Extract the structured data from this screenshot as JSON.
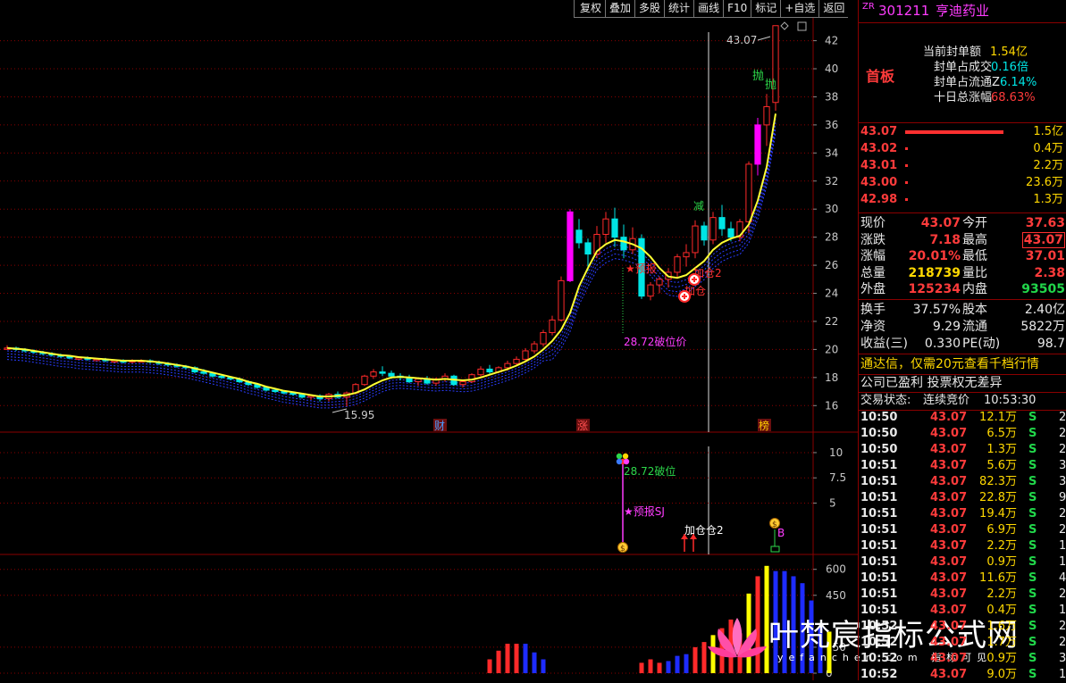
{
  "toolbar": {
    "items": [
      "复权",
      "叠加",
      "多股",
      "统计",
      "画线",
      "F10",
      "标记",
      "+自选",
      "返回"
    ]
  },
  "stock": {
    "prefix": "ZR",
    "code": "301211",
    "name": "亨迪药业"
  },
  "board_label": "首板",
  "seal_info": [
    {
      "label": "当前封单额",
      "value": "1.54亿"
    },
    {
      "label": "封单占成交",
      "value": "0.16倍"
    },
    {
      "label": "封单占流通Z",
      "value": "6.14%"
    },
    {
      "label": "十日总涨幅",
      "value": "68.63%"
    }
  ],
  "order_book": [
    {
      "price": "43.07",
      "vol": "1.5亿",
      "bar": 1.0
    },
    {
      "price": "43.02",
      "vol": "0.4万",
      "bar": 0.02
    },
    {
      "price": "43.01",
      "vol": "2.2万",
      "bar": 0.02
    },
    {
      "price": "43.00",
      "vol": "23.6万",
      "bar": 0.02
    },
    {
      "price": "42.98",
      "vol": "1.3万",
      "bar": 0.02
    }
  ],
  "quote": [
    {
      "l1": "现价",
      "v1": "43.07",
      "l2": "今开",
      "v2": "37.63"
    },
    {
      "l1": "涨跌",
      "v1": "7.18",
      "l2": "最高",
      "v2": "43.07"
    },
    {
      "l1": "涨幅",
      "v1": "20.01%",
      "l2": "最低",
      "v2": "37.01"
    },
    {
      "l1": "总量",
      "v1": "218739",
      "l2": "量比",
      "v2": "2.38"
    },
    {
      "l1": "外盘",
      "v1": "125234",
      "l2": "内盘",
      "v2": "93505"
    }
  ],
  "finance": [
    {
      "l1": "换手",
      "v1": "37.57%",
      "l2": "股本",
      "v2": "2.40亿"
    },
    {
      "l1": "净资",
      "v1": "9.29",
      "l2": "流通",
      "v2": "5822万"
    },
    {
      "l1": "收益(三)",
      "v1": "0.330",
      "l2": "PE(动)",
      "v2": "98.7"
    }
  ],
  "promo": "通达信，仅需20元查看千档行情",
  "notice": "公司已盈利 投票权无差异",
  "trade_state": {
    "label": "交易状态:",
    "state": "连续竞价",
    "time": "10:53:30"
  },
  "ticks": [
    {
      "t": "10:50",
      "p": "43.07",
      "v": "12.1万",
      "s": "S",
      "n": "2"
    },
    {
      "t": "10:50",
      "p": "43.07",
      "v": "6.5万",
      "s": "S",
      "n": "2"
    },
    {
      "t": "10:50",
      "p": "43.07",
      "v": "1.3万",
      "s": "S",
      "n": "2"
    },
    {
      "t": "10:51",
      "p": "43.07",
      "v": "5.6万",
      "s": "S",
      "n": "3"
    },
    {
      "t": "10:51",
      "p": "43.07",
      "v": "82.3万",
      "s": "S",
      "n": "3"
    },
    {
      "t": "10:51",
      "p": "43.07",
      "v": "22.8万",
      "s": "S",
      "n": "9"
    },
    {
      "t": "10:51",
      "p": "43.07",
      "v": "19.4万",
      "s": "S",
      "n": "2"
    },
    {
      "t": "10:51",
      "p": "43.07",
      "v": "6.9万",
      "s": "S",
      "n": "2"
    },
    {
      "t": "10:51",
      "p": "43.07",
      "v": "2.2万",
      "s": "S",
      "n": "1"
    },
    {
      "t": "10:51",
      "p": "43.07",
      "v": "0.9万",
      "s": "S",
      "n": "1"
    },
    {
      "t": "10:51",
      "p": "43.07",
      "v": "11.6万",
      "s": "S",
      "n": "4"
    },
    {
      "t": "10:51",
      "p": "43.07",
      "v": "2.2万",
      "s": "S",
      "n": "2"
    },
    {
      "t": "10:51",
      "p": "43.07",
      "v": "0.4万",
      "s": "S",
      "n": "1"
    },
    {
      "t": "10:52",
      "p": "43.07",
      "v": "1.6万",
      "s": "S",
      "n": "2"
    },
    {
      "t": "10:52",
      "p": "43.07",
      "v": "1.7万",
      "s": "S",
      "n": "2"
    },
    {
      "t": "10:52",
      "p": "43.07",
      "v": "0.9万",
      "s": "S",
      "n": "3"
    },
    {
      "t": "10:52",
      "p": "43.07",
      "v": "9.0万",
      "s": "S",
      "n": "1"
    }
  ],
  "chart_labels": {
    "high_mark": "43.07",
    "low_mark": "15.95",
    "break_price": "28.72破位价",
    "break_sub": "28.72破位",
    "forecast": "★预报",
    "forecast_sj": "★预报SJ",
    "add_pos": "加仓",
    "add_pos2": "加仓2",
    "add_pos_sub": "加仓仓2",
    "reduce": "减",
    "sell1": "抛",
    "sell2": "抛",
    "b_mark": "B",
    "marker_cai": "财",
    "marker_zhang": "涨",
    "marker_bang": "榜"
  },
  "watermark": {
    "text": "叶梵宸指标公式网",
    "url": "yefanchen.com 指标可见"
  },
  "colors": {
    "up": "#ff2a2a",
    "down": "#00e5e5",
    "limit": "#ff00ff",
    "ma": "#ffff33",
    "band": "#2a3cff",
    "grid": "#8a0000",
    "axis": "#c8c8c8"
  },
  "chart_data": [
    {
      "type": "candlestick",
      "title": "",
      "y_ticks": [
        16,
        18,
        20,
        22,
        24,
        26,
        28,
        30,
        32,
        34,
        36,
        38,
        40,
        42
      ],
      "ylim": [
        15,
        43.5
      ],
      "candles": [
        [
          20.1,
          20.3,
          20.0,
          20.1
        ],
        [
          20.1,
          20.2,
          19.9,
          20.0
        ],
        [
          20.0,
          20.1,
          19.8,
          19.9
        ],
        [
          19.9,
          20.0,
          19.7,
          19.8
        ],
        [
          19.8,
          19.9,
          19.6,
          19.7
        ],
        [
          19.7,
          19.8,
          19.5,
          19.6
        ],
        [
          19.6,
          19.7,
          19.4,
          19.5
        ],
        [
          19.5,
          19.6,
          19.3,
          19.4
        ],
        [
          19.4,
          19.5,
          19.3,
          19.4
        ],
        [
          19.4,
          19.5,
          19.2,
          19.3
        ],
        [
          19.3,
          19.4,
          19.2,
          19.3
        ],
        [
          19.3,
          19.4,
          19.1,
          19.2
        ],
        [
          19.2,
          19.3,
          19.1,
          19.2
        ],
        [
          19.2,
          19.3,
          19.0,
          19.1
        ],
        [
          19.1,
          19.3,
          19.0,
          19.2
        ],
        [
          19.2,
          19.3,
          19.1,
          19.2
        ],
        [
          19.2,
          19.3,
          19.0,
          19.1
        ],
        [
          19.1,
          19.2,
          18.9,
          19.0
        ],
        [
          19.0,
          19.1,
          18.8,
          18.9
        ],
        [
          18.9,
          19.0,
          18.7,
          18.8
        ],
        [
          18.8,
          18.9,
          18.6,
          18.7
        ],
        [
          18.7,
          18.8,
          18.3,
          18.4
        ],
        [
          18.4,
          18.6,
          18.2,
          18.3
        ],
        [
          18.3,
          18.4,
          18.0,
          18.1
        ],
        [
          18.1,
          18.2,
          17.9,
          18.0
        ],
        [
          18.0,
          18.1,
          17.8,
          17.9
        ],
        [
          17.9,
          18.0,
          17.6,
          17.7
        ],
        [
          17.7,
          17.8,
          17.4,
          17.5
        ],
        [
          17.5,
          17.6,
          17.2,
          17.3
        ],
        [
          17.3,
          17.4,
          17.0,
          17.1
        ],
        [
          17.1,
          17.2,
          16.9,
          17.0
        ],
        [
          17.0,
          17.1,
          16.8,
          16.9
        ],
        [
          16.9,
          17.0,
          16.7,
          16.8
        ],
        [
          16.8,
          16.9,
          16.5,
          16.6
        ],
        [
          16.6,
          16.8,
          16.4,
          16.7
        ],
        [
          16.7,
          16.8,
          16.3,
          16.5
        ],
        [
          16.5,
          16.9,
          16.3,
          16.8
        ],
        [
          16.8,
          17.0,
          16.5,
          16.6
        ],
        [
          16.6,
          17.0,
          15.95,
          16.9
        ],
        [
          16.9,
          17.6,
          16.8,
          17.5
        ],
        [
          17.5,
          18.2,
          17.4,
          18.1
        ],
        [
          18.1,
          18.6,
          17.9,
          18.4
        ],
        [
          18.4,
          18.8,
          18.1,
          18.3
        ],
        [
          18.3,
          18.5,
          17.9,
          18.1
        ],
        [
          18.1,
          18.3,
          17.8,
          18.0
        ],
        [
          18.0,
          18.2,
          17.6,
          17.7
        ],
        [
          17.7,
          18.0,
          17.4,
          17.9
        ],
        [
          17.9,
          18.1,
          17.5,
          17.6
        ],
        [
          17.6,
          18.0,
          17.4,
          17.9
        ],
        [
          17.9,
          18.3,
          17.7,
          18.1
        ],
        [
          18.1,
          18.2,
          17.4,
          17.5
        ],
        [
          17.5,
          17.8,
          17.3,
          17.7
        ],
        [
          17.7,
          18.3,
          17.6,
          18.2
        ],
        [
          18.2,
          18.8,
          18.0,
          18.6
        ],
        [
          18.6,
          18.9,
          18.2,
          18.4
        ],
        [
          18.4,
          18.8,
          18.3,
          18.7
        ],
        [
          18.7,
          19.2,
          18.5,
          19.0
        ],
        [
          19.0,
          19.5,
          18.8,
          19.3
        ],
        [
          19.3,
          20.1,
          19.1,
          19.9
        ],
        [
          19.9,
          20.6,
          19.7,
          20.4
        ],
        [
          20.4,
          21.4,
          20.2,
          21.2
        ],
        [
          21.2,
          22.4,
          21.0,
          22.1
        ],
        [
          22.1,
          25.2,
          22.0,
          24.9
        ],
        [
          24.9,
          30.0,
          24.8,
          29.8
        ],
        [
          28.5,
          29.3,
          27.2,
          27.6
        ],
        [
          27.6,
          27.9,
          25.6,
          26.8
        ],
        [
          26.8,
          28.8,
          26.5,
          28.2
        ],
        [
          28.2,
          29.8,
          27.6,
          29.3
        ],
        [
          29.3,
          30.1,
          27.3,
          28.0
        ],
        [
          28.0,
          28.9,
          26.5,
          27.1
        ],
        [
          27.1,
          28.7,
          26.8,
          27.9
        ],
        [
          27.9,
          28.2,
          23.6,
          23.8
        ],
        [
          23.8,
          24.8,
          23.5,
          24.6
        ],
        [
          24.6,
          25.2,
          24.0,
          25.0
        ],
        [
          25.0,
          25.8,
          24.4,
          25.5
        ],
        [
          25.5,
          26.8,
          25.1,
          26.6
        ],
        [
          26.6,
          27.5,
          25.9,
          26.9
        ],
        [
          26.9,
          29.2,
          26.5,
          28.8
        ],
        [
          28.8,
          29.1,
          27.4,
          27.8
        ],
        [
          27.8,
          29.8,
          27.5,
          29.4
        ],
        [
          29.4,
          30.3,
          28.1,
          28.6
        ],
        [
          28.6,
          29.1,
          27.7,
          28.0
        ],
        [
          28.0,
          29.3,
          27.7,
          29.1
        ],
        [
          29.1,
          33.4,
          28.3,
          33.2
        ],
        [
          33.2,
          36.5,
          32.4,
          36.0
        ],
        [
          36.0,
          38.2,
          34.5,
          37.3
        ],
        [
          37.6,
          43.07,
          37.01,
          43.07
        ]
      ],
      "ma": [
        20.1,
        20.05,
        20.0,
        19.9,
        19.8,
        19.7,
        19.6,
        19.55,
        19.45,
        19.4,
        19.35,
        19.3,
        19.25,
        19.2,
        19.2,
        19.2,
        19.15,
        19.1,
        19.0,
        18.9,
        18.8,
        18.65,
        18.5,
        18.35,
        18.2,
        18.05,
        17.9,
        17.7,
        17.55,
        17.35,
        17.2,
        17.05,
        16.95,
        16.85,
        16.75,
        16.65,
        16.65,
        16.7,
        16.75,
        16.9,
        17.15,
        17.5,
        17.8,
        18.0,
        18.05,
        18.0,
        17.95,
        17.9,
        17.85,
        17.9,
        17.85,
        17.8,
        17.85,
        18.0,
        18.2,
        18.4,
        18.6,
        18.85,
        19.15,
        19.5,
        20.0,
        20.6,
        21.4,
        22.6,
        24.5,
        25.8,
        27.0,
        27.5,
        27.8,
        27.7,
        27.5,
        27.2,
        26.6,
        25.8,
        25.2,
        25.1,
        25.3,
        25.8,
        26.3,
        27.1,
        27.6,
        27.9,
        28.1,
        28.9,
        30.6,
        33.0,
        36.8
      ]
    },
    {
      "type": "signal",
      "y_ticks": [
        5.0,
        7.5,
        10.0
      ],
      "ylim": [
        0,
        11.5
      ]
    },
    {
      "type": "bar",
      "y_ticks": [
        0,
        150,
        450,
        600
      ],
      "ylim": [
        0,
        650
      ],
      "bars": [
        [
          54,
          "#ff2a2a",
          80
        ],
        [
          55,
          "#ff2a2a",
          130
        ],
        [
          56,
          "#ff2a2a",
          170
        ],
        [
          57,
          "#ff2a2a",
          170
        ],
        [
          58,
          "#1e2cff",
          170
        ],
        [
          59,
          "#1e2cff",
          120
        ],
        [
          60,
          "#1e2cff",
          80
        ],
        [
          71,
          "#ff2a2a",
          60
        ],
        [
          72,
          "#ff2a2a",
          80
        ],
        [
          73,
          "#ff2a2a",
          60
        ],
        [
          74,
          "#1e2cff",
          70
        ],
        [
          75,
          "#1e2cff",
          100
        ],
        [
          76,
          "#1e2cff",
          110
        ],
        [
          77,
          "#ff2a2a",
          150
        ],
        [
          78,
          "#ff2a2a",
          180
        ],
        [
          79,
          "#ffff00",
          220
        ],
        [
          80,
          "#ff2a2a",
          260
        ],
        [
          81,
          "#ff2a2a",
          310
        ],
        [
          82,
          "#ff2a2a",
          230
        ],
        [
          83,
          "#ffff00",
          460
        ],
        [
          84,
          "#ff2a2a",
          560
        ],
        [
          85,
          "#ffff00",
          620
        ],
        [
          86,
          "#1e2cff",
          590
        ],
        [
          87,
          "#1e2cff",
          590
        ],
        [
          88,
          "#1e2cff",
          560
        ],
        [
          89,
          "#1e2cff",
          520
        ],
        [
          90,
          "#1e2cff",
          420
        ],
        [
          91,
          "#1e2cff",
          270
        ],
        [
          92,
          "#ffff00",
          240
        ],
        [
          101,
          "#ffff00",
          70
        ],
        [
          102,
          "#ff2a2a",
          120
        ],
        [
          103,
          "#ff2a2a",
          160
        ],
        [
          104,
          "#ff2a2a",
          200
        ],
        [
          105,
          "#ff2a2a",
          270
        ],
        [
          106,
          "#1e2cff",
          240
        ],
        [
          107,
          "#ff2a2a",
          290
        ],
        [
          108,
          "#ff2a2a",
          340
        ],
        [
          109,
          "#ff2a2a",
          400
        ],
        [
          110,
          "#ff2a2a",
          450
        ],
        [
          111,
          "#ffff00",
          560
        ]
      ]
    }
  ]
}
